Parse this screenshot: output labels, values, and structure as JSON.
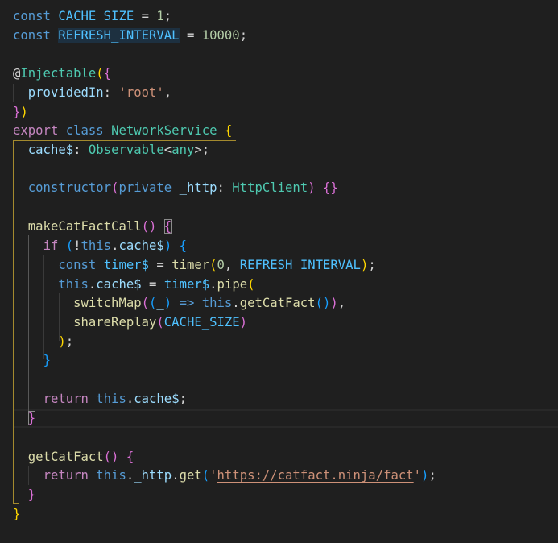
{
  "editor": {
    "language": "typescript",
    "code_lines": [
      "const CACHE_SIZE = 1;",
      "const REFRESH_INTERVAL = 10000;",
      "",
      "@Injectable({",
      "  providedIn: 'root',",
      "})",
      "export class NetworkService {",
      "  cache$: Observable<any>;",
      "",
      "  constructor(private _http: HttpClient) {}",
      "",
      "  makeCatFactCall() {",
      "    if (!this.cache$) {",
      "      const timer$ = timer(0, REFRESH_INTERVAL);",
      "      this.cache$ = timer$.pipe(",
      "        switchMap((_) => this.getCatFact()),",
      "        shareReplay(CACHE_SIZE)",
      "      );",
      "    }",
      "",
      "    return this.cache$;",
      "  }",
      "",
      "  getCatFact() {",
      "    return this._http.get('https://catfact.ninja/fact');",
      "  }",
      "}"
    ],
    "tokens": {
      "l1": [
        "const",
        "CACHE_SIZE",
        "=",
        "1",
        ";"
      ],
      "l2": [
        "const",
        "REFRESH_INTERVAL",
        "=",
        "10000",
        ";"
      ],
      "l4": [
        "@",
        "Injectable",
        "(",
        "{"
      ],
      "l5": [
        "providedIn",
        ":",
        "'root'",
        ","
      ],
      "l6": [
        "}",
        ")"
      ],
      "l7": [
        "export",
        "class",
        "NetworkService",
        "{"
      ],
      "l8": [
        "cache$",
        ":",
        "Observable",
        "<",
        "any",
        ">;"
      ],
      "l10": [
        "constructor",
        "(",
        "private",
        "_http",
        ":",
        "HttpClient",
        ")",
        "{}"
      ],
      "l12": [
        "makeCatFactCall",
        "()",
        "{"
      ],
      "l13": [
        "if",
        "(",
        "!",
        "this",
        ".",
        "cache$",
        ")",
        "{"
      ],
      "l14": [
        "const",
        "timer$",
        "=",
        "timer",
        "(",
        "0",
        ",",
        "REFRESH_INTERVAL",
        ")",
        ";"
      ],
      "l15": [
        "this",
        ".",
        "cache$",
        "=",
        "timer$",
        ".",
        "pipe",
        "("
      ],
      "l16": [
        "switchMap",
        "(",
        "(",
        "_",
        ")",
        "=>",
        "this",
        ".",
        "getCatFact",
        "()",
        ")",
        ","
      ],
      "l17": [
        "shareReplay",
        "(",
        "CACHE_SIZE",
        ")"
      ],
      "l18": [
        ")",
        ";"
      ],
      "l19": [
        "}"
      ],
      "l21": [
        "return",
        "this",
        ".",
        "cache$",
        ";"
      ],
      "l22": [
        "}"
      ],
      "l24": [
        "getCatFact",
        "()",
        "{"
      ],
      "l25": [
        "return",
        "this",
        ".",
        "_http",
        ".",
        "get",
        "(",
        "'",
        "https://catfact.ninja/fact",
        "'",
        ")",
        ";"
      ],
      "l26": [
        "}"
      ],
      "l27": [
        "}"
      ]
    },
    "selected_word": "REFRESH_INTERVAL",
    "matched_bracket_line": 12,
    "cursor_line": 22,
    "colors": {
      "background": "#1f1f1f",
      "keyword": "#569cd6",
      "control": "#c586c0",
      "variable": "#9cdcfe",
      "constant": "#4fc1ff",
      "type": "#4ec9b0",
      "function": "#dcdcaa",
      "number": "#b5cea8",
      "string": "#ce9178",
      "bracket_1": "#ffd700",
      "bracket_2": "#da70d6",
      "bracket_3": "#179fff"
    }
  }
}
